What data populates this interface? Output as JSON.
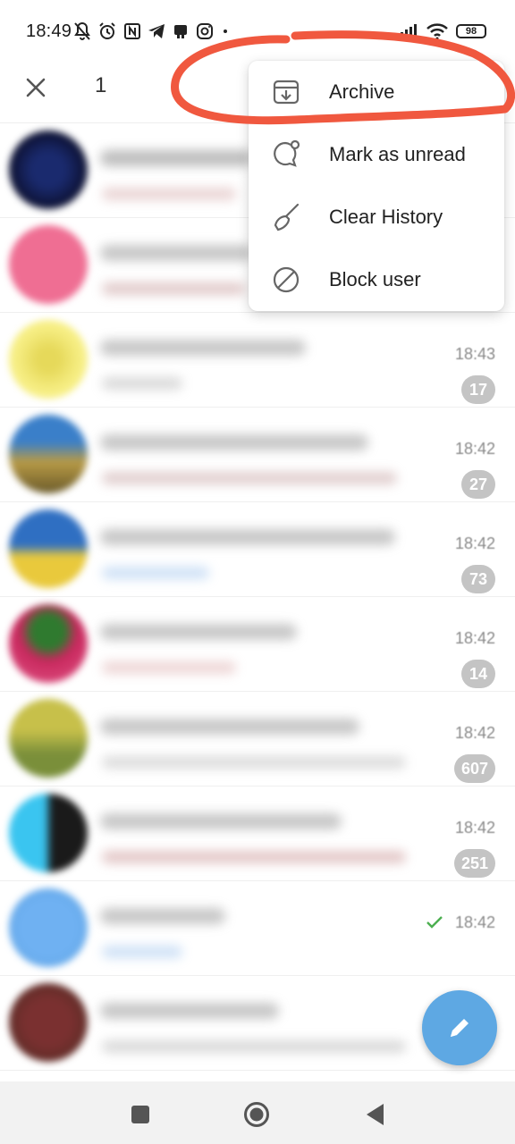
{
  "status_bar": {
    "time": "18:49",
    "battery": "98",
    "left_icons": [
      "bell-off-icon",
      "alarm-icon",
      "nfc-icon",
      "telegram-icon",
      "bot-icon",
      "instagram-icon",
      "dot-icon"
    ],
    "right_icons": [
      "signal-icon",
      "wifi-icon",
      "battery-icon"
    ]
  },
  "header": {
    "selected_count": "1"
  },
  "context_menu": {
    "items": [
      {
        "label": "Archive",
        "icon": "archive-icon"
      },
      {
        "label": "Mark as unread",
        "icon": "mark-unread-icon"
      },
      {
        "label": "Clear History",
        "icon": "broom-icon"
      },
      {
        "label": "Block user",
        "icon": "block-icon"
      }
    ]
  },
  "chats": [
    {
      "time": "",
      "badge": ""
    },
    {
      "time": "",
      "badge": ""
    },
    {
      "time": "18:43",
      "badge": "17"
    },
    {
      "time": "18:42",
      "badge": "27"
    },
    {
      "time": "18:42",
      "badge": "73"
    },
    {
      "time": "18:42",
      "badge": "14"
    },
    {
      "time": "18:42",
      "badge": "607"
    },
    {
      "time": "18:42",
      "badge": "251"
    },
    {
      "time": "18:42",
      "badge": "",
      "read": true
    },
    {
      "time": "",
      "badge": ""
    }
  ],
  "colors": {
    "accent": "#5ea8e3",
    "annotation": "#f0583f",
    "badge": "#c4c4c4",
    "check": "#4caf50"
  }
}
